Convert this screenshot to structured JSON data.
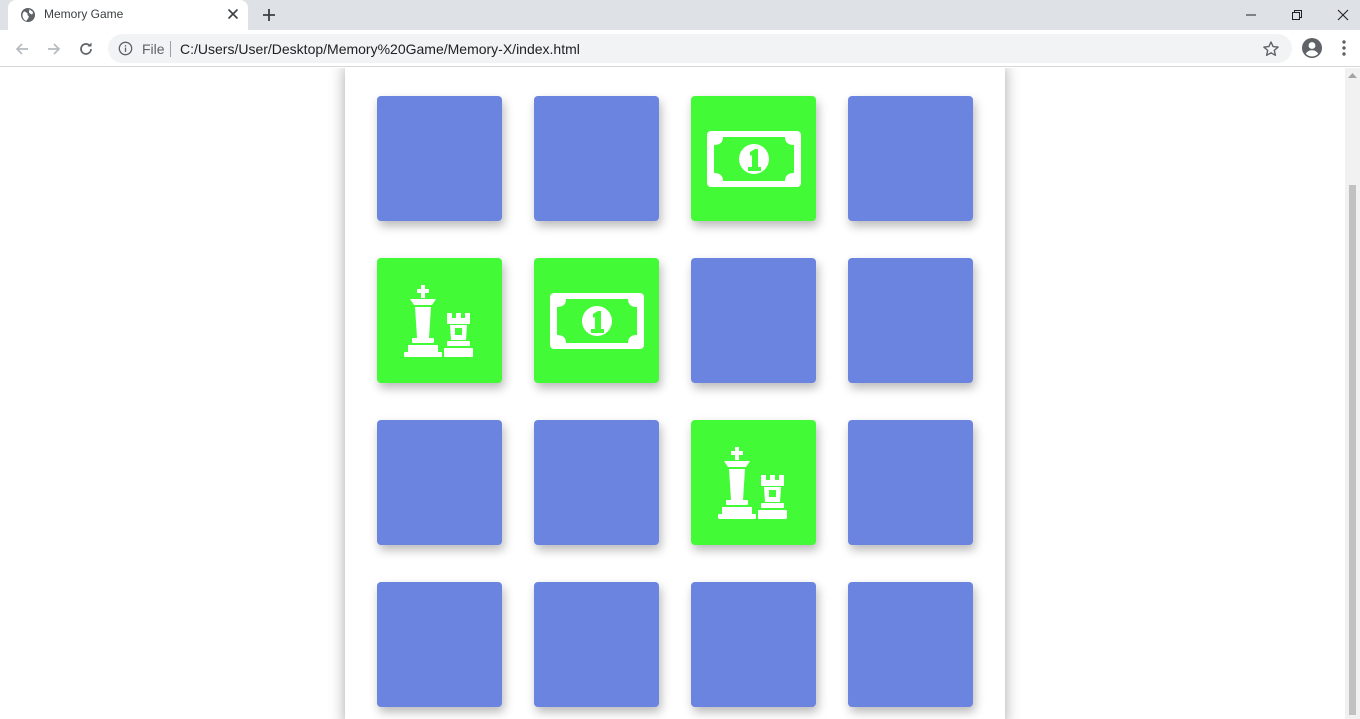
{
  "browser": {
    "tab_title": "Memory Game",
    "scheme_label": "File",
    "url": "C:/Users/User/Desktop/Memory%20Game/Memory-X/index.html"
  },
  "colors": {
    "card_back": "#6a84e0",
    "card_front": "#43fa37",
    "icon": "#ffffff"
  },
  "game": {
    "rows": 4,
    "columns": 4,
    "cards": [
      {
        "state": "hidden",
        "icon": null
      },
      {
        "state": "hidden",
        "icon": null
      },
      {
        "state": "flipped",
        "icon": "money-bill-icon"
      },
      {
        "state": "hidden",
        "icon": null
      },
      {
        "state": "flipped",
        "icon": "chess-icon"
      },
      {
        "state": "flipped",
        "icon": "money-bill-icon"
      },
      {
        "state": "hidden",
        "icon": null
      },
      {
        "state": "hidden",
        "icon": null
      },
      {
        "state": "hidden",
        "icon": null
      },
      {
        "state": "hidden",
        "icon": null
      },
      {
        "state": "flipped",
        "icon": "chess-icon"
      },
      {
        "state": "hidden",
        "icon": null
      },
      {
        "state": "hidden",
        "icon": null
      },
      {
        "state": "hidden",
        "icon": null
      },
      {
        "state": "hidden",
        "icon": null
      },
      {
        "state": "hidden",
        "icon": null
      }
    ]
  }
}
